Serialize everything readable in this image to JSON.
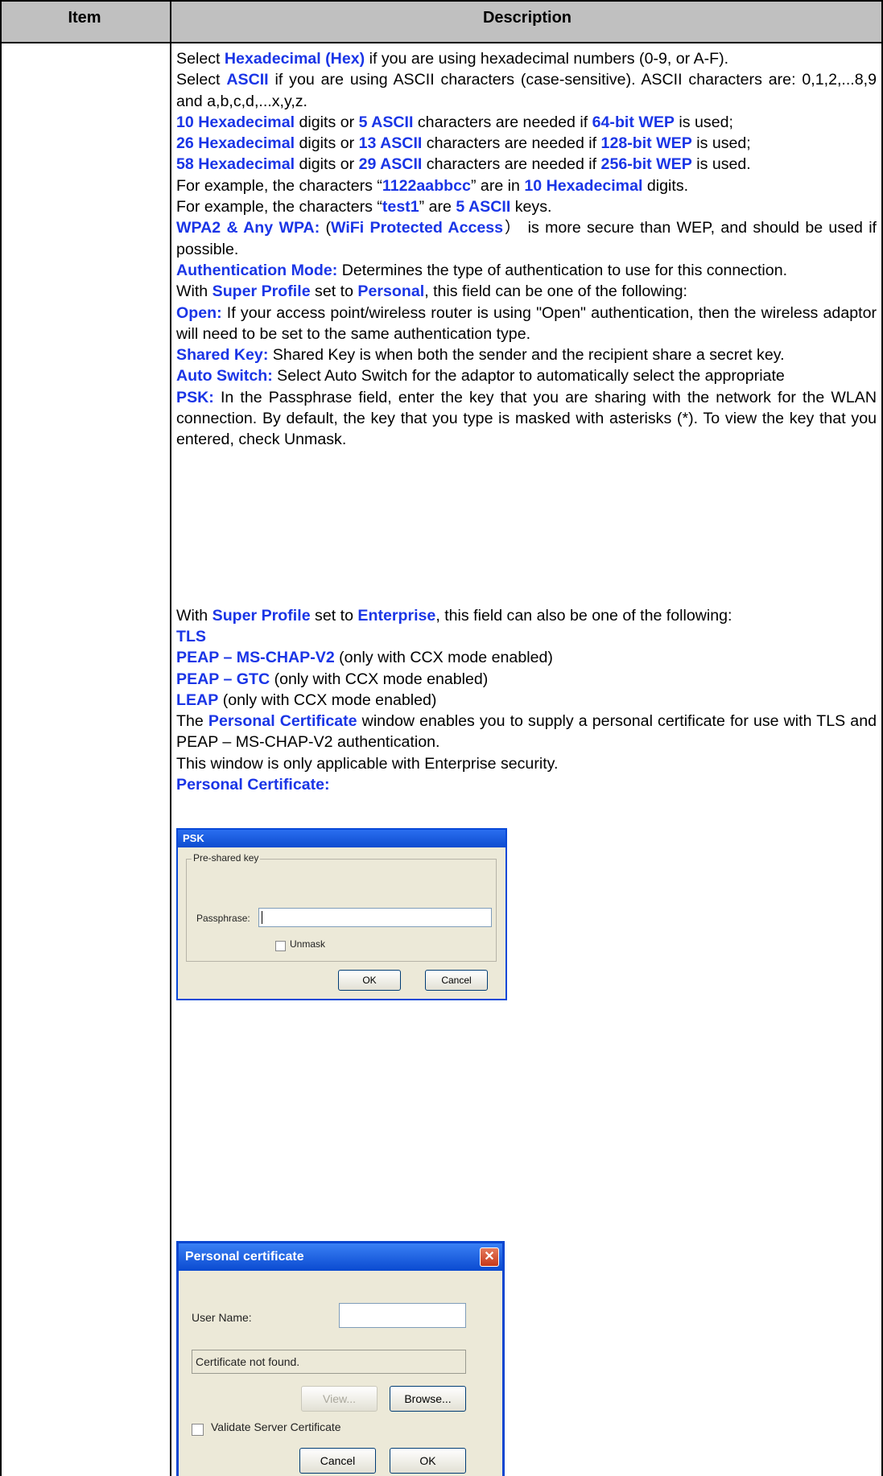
{
  "table": {
    "header_item": "Item",
    "header_description": "Description"
  },
  "description": {
    "p1": {
      "a": "Select ",
      "b": "Hexadecimal (Hex)",
      "c": " if you are using hexadecimal numbers (0-9, or A-F)."
    },
    "p2": {
      "a": "Select ",
      "b": "ASCII",
      "c": " if you are using ASCII characters (case-sensitive). ASCII characters are: 0,1,2,...8,9 and a,b,c,d,...x,y,z."
    },
    "p3": {
      "b1": "10 Hexadecimal",
      "a": " digits or ",
      "b2": "5 ASCII",
      "c": " characters are needed if ",
      "b3": "64-bit WEP",
      "d": " is used;"
    },
    "p4": {
      "b1": "26 Hexadecimal",
      "a": " digits or ",
      "b2": "13 ASCII",
      "c": " characters are needed if ",
      "b3": "128-bit WEP",
      "d": " is used;"
    },
    "p5": {
      "b1": "58 Hexadecimal",
      "a": " digits or ",
      "b2": "29 ASCII",
      "c": " characters are needed if ",
      "b3": "256-bit WEP",
      "d": " is used."
    },
    "p6": {
      "a": "For example, the characters “",
      "b1": "1122aabbcc",
      "c": "” are in ",
      "b2": "10 Hexadecimal",
      "d": " digits."
    },
    "p7": {
      "a": "For example, the characters “",
      "b1": "test1",
      "c": "” are ",
      "b2": "5 ASCII",
      "d": " keys."
    },
    "p8": {
      "b1": "WPA2 & Any WPA:",
      "a": " (",
      "b2": "WiFi Protected Access",
      "c": "） is more secure than WEP, and should be used if possible."
    },
    "p9": {
      "b": "Authentication Mode:",
      "c": " Determines the type of authentication to use for this connection."
    },
    "p10": {
      "a": "With ",
      "b1": "Super Profile",
      "c": " set to ",
      "b2": "Personal",
      "d": ", this field can be one of the following:"
    },
    "p11": {
      "b": "Open:",
      "c": " If your access point/wireless router is using \"Open\" authentication, then the wireless adaptor will need to be set to the same authentication type."
    },
    "p12": {
      "b": "Shared Key:",
      "c": " Shared Key is when both the sender and the recipient share a secret key."
    },
    "p13": {
      "b": "Auto Switch:",
      "c": " Select Auto Switch for the adaptor to automatically select the appropriate"
    },
    "p14": {
      "b": "PSK:",
      "c": " In the Passphrase field, enter the key that you are sharing with the network for the WLAN connection. By default, the key that you type is masked with asterisks (*). To view the key that you entered, check Unmask."
    },
    "p15": {
      "a": "With ",
      "b1": "Super Profile",
      "c": " set to ",
      "b2": "Enterprise",
      "d": ", this field can also be one of the following:"
    },
    "p16": {
      "b": "TLS"
    },
    "p17": {
      "b": "PEAP – MS-CHAP-V2",
      "c": " (only with CCX mode enabled)"
    },
    "p18": {
      "b": "PEAP – GTC",
      "c": " (only with CCX mode enabled)"
    },
    "p19": {
      "b": "LEAP",
      "c": " (only with CCX mode enabled)"
    },
    "p20": {
      "a": "The ",
      "b": "Personal Certificate",
      "c": " window enables you to supply a personal certificate for use with TLS and PEAP – MS-CHAP-V2 authentication."
    },
    "p21": {
      "a": "This window is only applicable with Enterprise security."
    },
    "p22": {
      "b": "Personal Certificate:"
    }
  },
  "psk_dialog": {
    "title": "PSK",
    "group_label": "Pre-shared key",
    "passphrase_label": "Passphrase:",
    "passphrase_value": "",
    "unmask_label": "Unmask",
    "ok_label": "OK",
    "cancel_label": "Cancel"
  },
  "cert_dialog": {
    "title": "Personal certificate",
    "close_glyph": "✕",
    "username_label": "User Name:",
    "username_value": "",
    "status_text": "Certificate not found.",
    "view_label": "View...",
    "browse_label": "Browse...",
    "validate_label": "Validate Server Certificate",
    "cancel_label": "Cancel",
    "ok_label": "OK"
  },
  "colors": {
    "highlight": "#1a35e6",
    "header_bg": "#c0c0c0",
    "dialog_bg": "#ece9d8",
    "titlebar": "#0a4ad0"
  }
}
